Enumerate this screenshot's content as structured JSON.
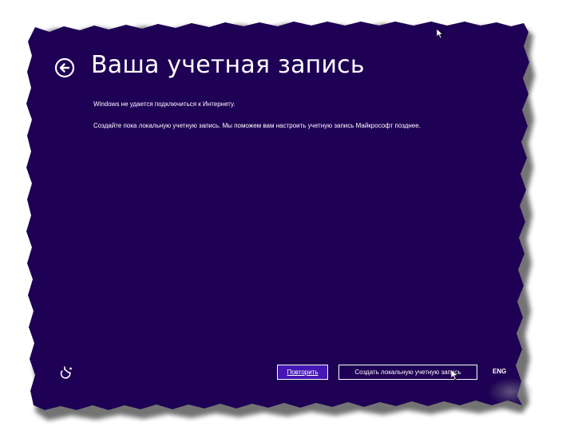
{
  "page": {
    "title": "Ваша учетная запись",
    "message_line1": "Windows не удается подключиться к Интернету.",
    "message_line2": "Создайте пока локальную учетную запись. Мы поможем вам настроить учетную запись Майкрософт позднее."
  },
  "buttons": {
    "retry_label": "Повторить",
    "create_local_label": "Создать локальную учетную запись"
  },
  "language": "ENG",
  "icons": {
    "back": "back-arrow-circle-icon",
    "accessibility": "ease-of-access-icon",
    "cursor": "mouse-cursor-icon"
  },
  "colors": {
    "background": "#1e0054",
    "primary_button": "#4617b4",
    "text": "#ffffff"
  }
}
